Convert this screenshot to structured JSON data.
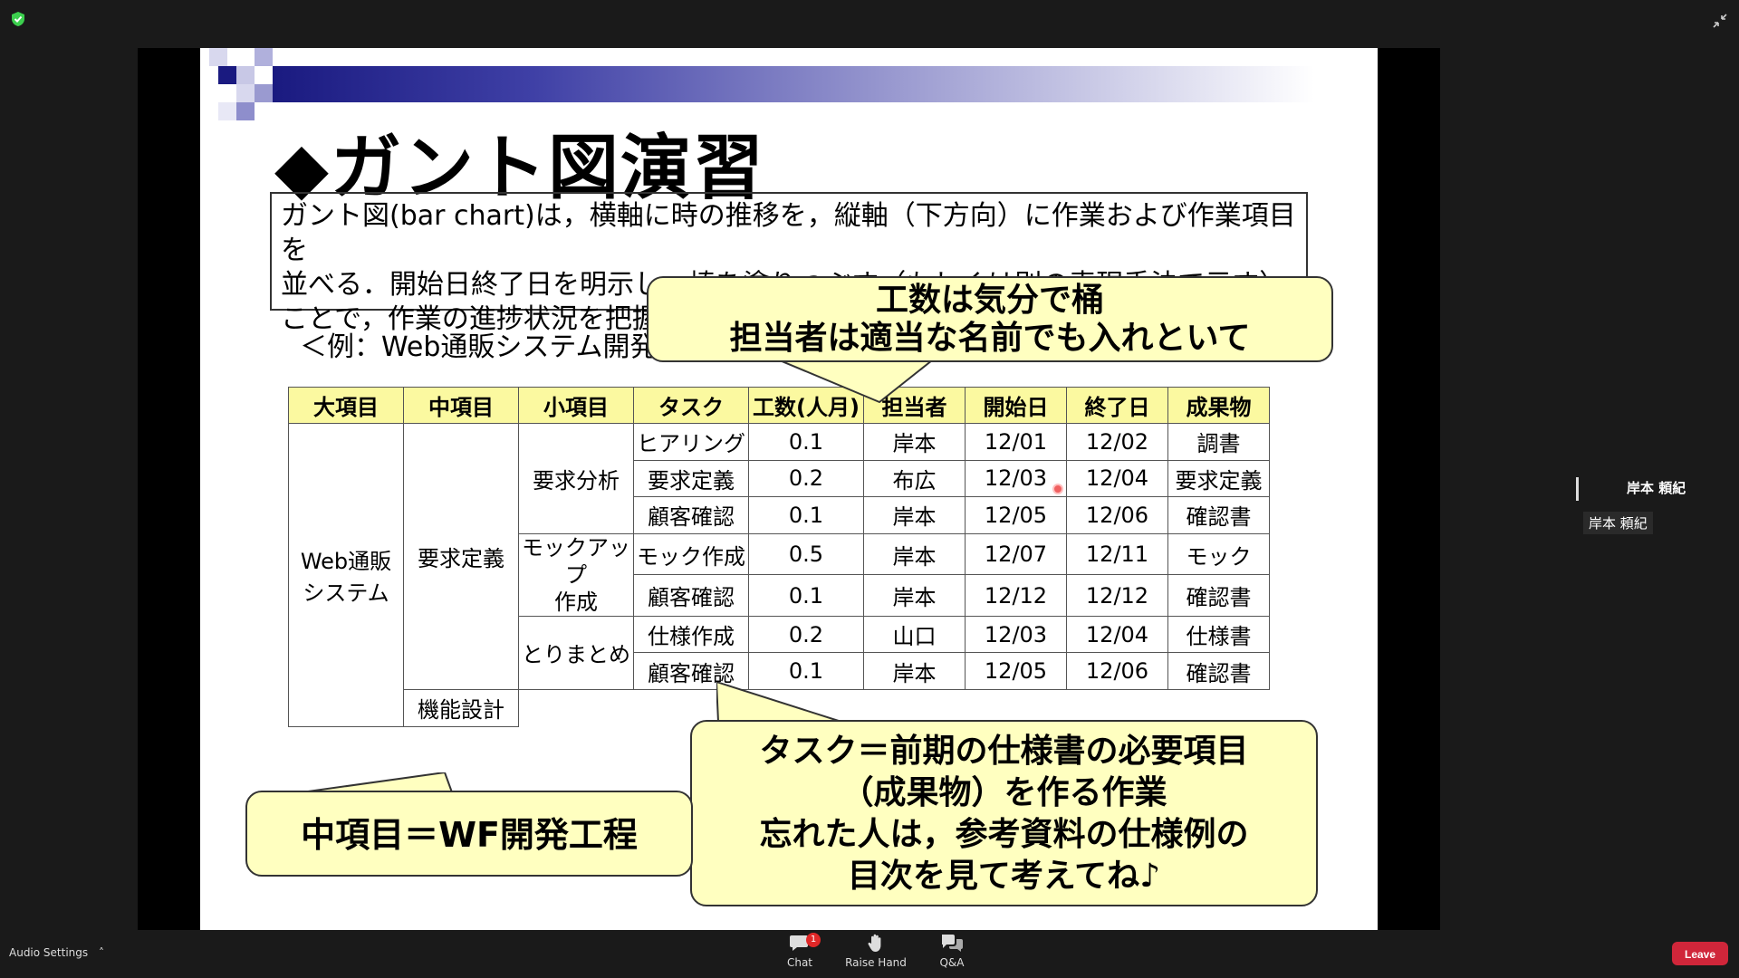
{
  "slide": {
    "title": "◆ガント図演習",
    "description": [
      "ガント図(bar chart)は，横軸に時の推移を，縦軸（下方向）に作業および作業項目を",
      "並べる．開始日終了日を明示し，棒を塗りつぶす（もしくは別の表現手法で示す）",
      "ことで，作業の進捗状況を把握"
    ],
    "example_label": "＜例：Web通販システム開発",
    "table": {
      "headers": [
        "大項目",
        "中項目",
        "小項目",
        "タスク",
        "工数(人月)",
        "担当者",
        "開始日",
        "終了日",
        "成果物"
      ],
      "major": "Web通販\nシステム",
      "middle_1": "要求定義",
      "middle_2": "機能設計",
      "minor_1": "要求分析",
      "minor_2": "モックアップ\n作成",
      "minor_3": "とりまとめ",
      "rows": [
        {
          "task": "ヒアリング",
          "effort": "0.1",
          "owner": "岸本",
          "start": "12/01",
          "end": "12/02",
          "output": "調書"
        },
        {
          "task": "要求定義",
          "effort": "0.2",
          "owner": "布広",
          "start": "12/03",
          "end": "12/04",
          "output": "要求定義"
        },
        {
          "task": "顧客確認",
          "effort": "0.1",
          "owner": "岸本",
          "start": "12/05",
          "end": "12/06",
          "output": "確認書"
        },
        {
          "task": "モック作成",
          "effort": "0.5",
          "owner": "岸本",
          "start": "12/07",
          "end": "12/11",
          "output": "モック"
        },
        {
          "task": "顧客確認",
          "effort": "0.1",
          "owner": "岸本",
          "start": "12/12",
          "end": "12/12",
          "output": "確認書"
        },
        {
          "task": "仕様作成",
          "effort": "0.2",
          "owner": "山口",
          "start": "12/03",
          "end": "12/04",
          "output": "仕様書"
        },
        {
          "task": "顧客確認",
          "effort": "0.1",
          "owner": "岸本",
          "start": "12/05",
          "end": "12/06",
          "output": "確認書"
        }
      ]
    },
    "callout_top": [
      "工数は気分で桶",
      "担当者は適当な名前でも入れといて"
    ],
    "callout_left": "中項目＝WF開発工程",
    "callout_right": [
      "タスク＝前期の仕様書の必要項目",
      "（成果物）を作る作業",
      "忘れた人は，参考資料の仕様例の",
      "目次を見て考えてね♪"
    ]
  },
  "participant": {
    "name": "岸本 頼紀",
    "tag": "岸本 頼紀"
  },
  "toolbar": {
    "audio_settings": "Audio Settings",
    "chat_label": "Chat",
    "chat_badge": "1",
    "raise_hand_label": "Raise Hand",
    "qa_label": "Q&A",
    "leave_label": "Leave"
  },
  "colors": {
    "header_fill": "#fbf9a0",
    "callout_fill": "#ffffc0",
    "leave_button": "#d0263a",
    "badge": "#e02828"
  }
}
